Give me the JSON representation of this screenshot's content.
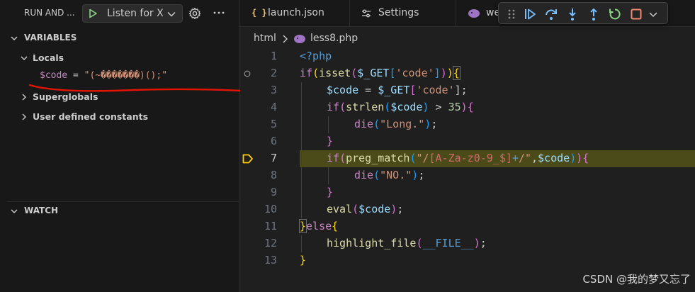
{
  "sidebar": {
    "title": "RUN AND ...",
    "config_label": "Listen for X",
    "sections": {
      "variables": "VARIABLES",
      "watch": "WATCH"
    },
    "scopes": [
      {
        "label": "Locals",
        "expanded": true
      },
      {
        "label": "Superglobals",
        "expanded": false
      },
      {
        "label": "User defined constants",
        "expanded": false
      }
    ],
    "locals": [
      {
        "name": "$code",
        "eq": " = ",
        "value": "\"(~�������)();\""
      }
    ]
  },
  "tabs": [
    {
      "icon": "{ }",
      "label": "launch.json"
    },
    {
      "icon": "settings-icon",
      "label": "Settings"
    },
    {
      "icon": "php-icon",
      "label": "we"
    }
  ],
  "breadcrumb": {
    "folder": "html",
    "file": "less8.php"
  },
  "editor": {
    "current_line": 7,
    "breakpoint_line": 2,
    "lines": [
      {
        "n": "1"
      },
      {
        "n": "2"
      },
      {
        "n": "3"
      },
      {
        "n": "4"
      },
      {
        "n": "5"
      },
      {
        "n": "6"
      },
      {
        "n": "7"
      },
      {
        "n": "8"
      },
      {
        "n": "9"
      },
      {
        "n": "10"
      },
      {
        "n": "11"
      },
      {
        "n": "12"
      },
      {
        "n": "13"
      }
    ],
    "code": {
      "l1": {
        "t1": "<?php"
      },
      "l2": {
        "t1": "if",
        "t2": "(",
        "t3": "isset",
        "t4": "(",
        "t5": "$_GET",
        "t6": "[",
        "t7": "'code'",
        "t8": "]",
        "t9": ")",
        "t10": ")",
        "t11": "{"
      },
      "l3": {
        "t1": "$code",
        "t2": " = ",
        "t3": "$_GET",
        "t4": "[",
        "t5": "'code'",
        "t6": "];"
      },
      "l4": {
        "t1": "if",
        "t2": "(",
        "t3": "strlen",
        "t4": "(",
        "t5": "$code",
        "t6": ")",
        "t7": " > ",
        "t8": "35",
        "t9": ")",
        "t10": "{"
      },
      "l5": {
        "t1": "die",
        "t2": "(",
        "t3": "\"Long.\"",
        "t4": ")",
        "t5": ";"
      },
      "l6": {
        "t1": "}"
      },
      "l7": {
        "t1": "if",
        "t2": "(",
        "t3": "preg_match",
        "t4": "(",
        "t5": "\"/",
        "t6": "[A-Za-z0-9_$]",
        "t7": "+",
        "t8": "/\"",
        "t9": ",",
        "t10": "$code",
        "t11": ")",
        "t12": ")",
        "t13": "{"
      },
      "l8": {
        "t1": "die",
        "t2": "(",
        "t3": "\"NO.\"",
        "t4": ")",
        "t5": ";"
      },
      "l9": {
        "t1": "}"
      },
      "l10": {
        "t1": "eval",
        "t2": "(",
        "t3": "$code",
        "t4": ")",
        "t5": ";"
      },
      "l11": {
        "t1": "}",
        "t2": "else",
        "t3": "{"
      },
      "l12": {
        "t1": "highlight_file",
        "t2": "(",
        "t3": "__FILE__",
        "t4": ")",
        "t5": ";"
      },
      "l13": {
        "t1": "}"
      }
    }
  },
  "debug_toolbar": {
    "actions": [
      "drag-handle",
      "continue",
      "step-over",
      "step-into",
      "step-out",
      "restart",
      "stop"
    ]
  },
  "watermark": "CSDN @我的梦又忘了",
  "colors": {
    "keyword": "#c586c0",
    "function": "#dcdcaa",
    "variable": "#9cdcfe",
    "string": "#ce9178",
    "number": "#b5cea8",
    "current_line_bg": "#4b4b1a",
    "annotation": "#e51400"
  }
}
